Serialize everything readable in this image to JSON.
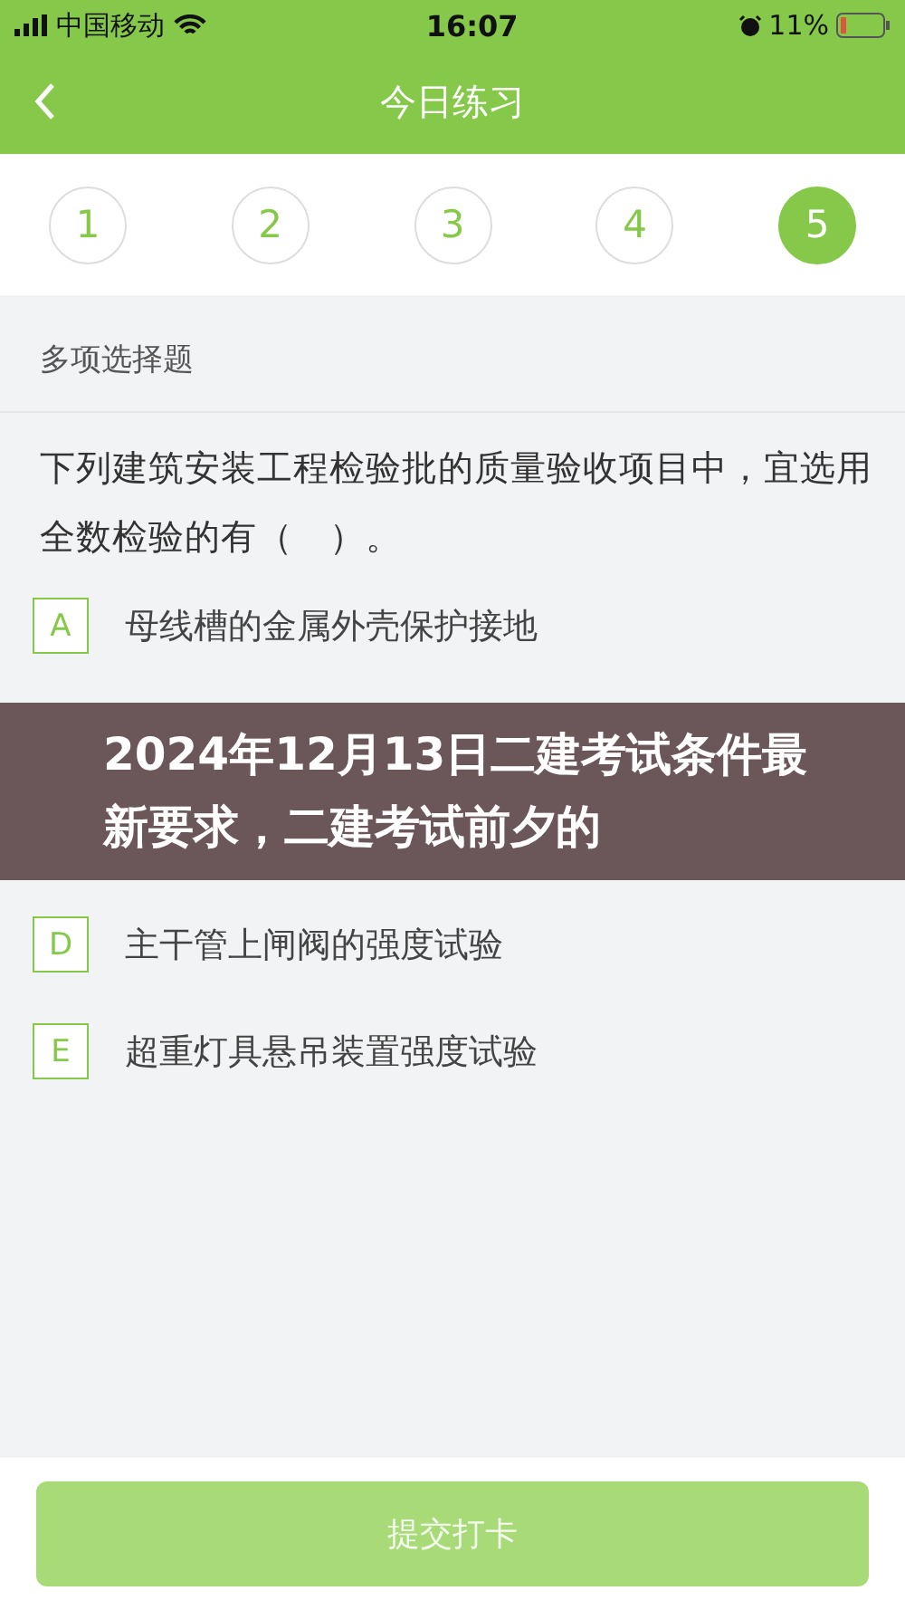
{
  "status_bar": {
    "carrier": "中国移动",
    "time": "16:07",
    "battery": "11%"
  },
  "nav": {
    "title": "今日练习"
  },
  "question_numbers": [
    {
      "label": "1",
      "selected": false
    },
    {
      "label": "2",
      "selected": false
    },
    {
      "label": "3",
      "selected": false
    },
    {
      "label": "4",
      "selected": false
    },
    {
      "label": "5",
      "selected": true
    }
  ],
  "question": {
    "type": "多项选择题",
    "text": "下列建筑安装工程检验批的质量验收项目中，宜选用全数检验的有（　）。"
  },
  "options_above_banner": [
    {
      "letter": "A",
      "text": "母线槽的金属外壳保护接地"
    }
  ],
  "banner": {
    "text": "2024年12月13日二建考试条件最新要求，二建考试前夕的"
  },
  "options_below_banner": [
    {
      "letter": "D",
      "text": "主干管上闸阀的强度试验"
    },
    {
      "letter": "E",
      "text": "超重灯具悬吊装置强度试验"
    }
  ],
  "submit": {
    "label": "提交打卡",
    "disabled": true
  }
}
